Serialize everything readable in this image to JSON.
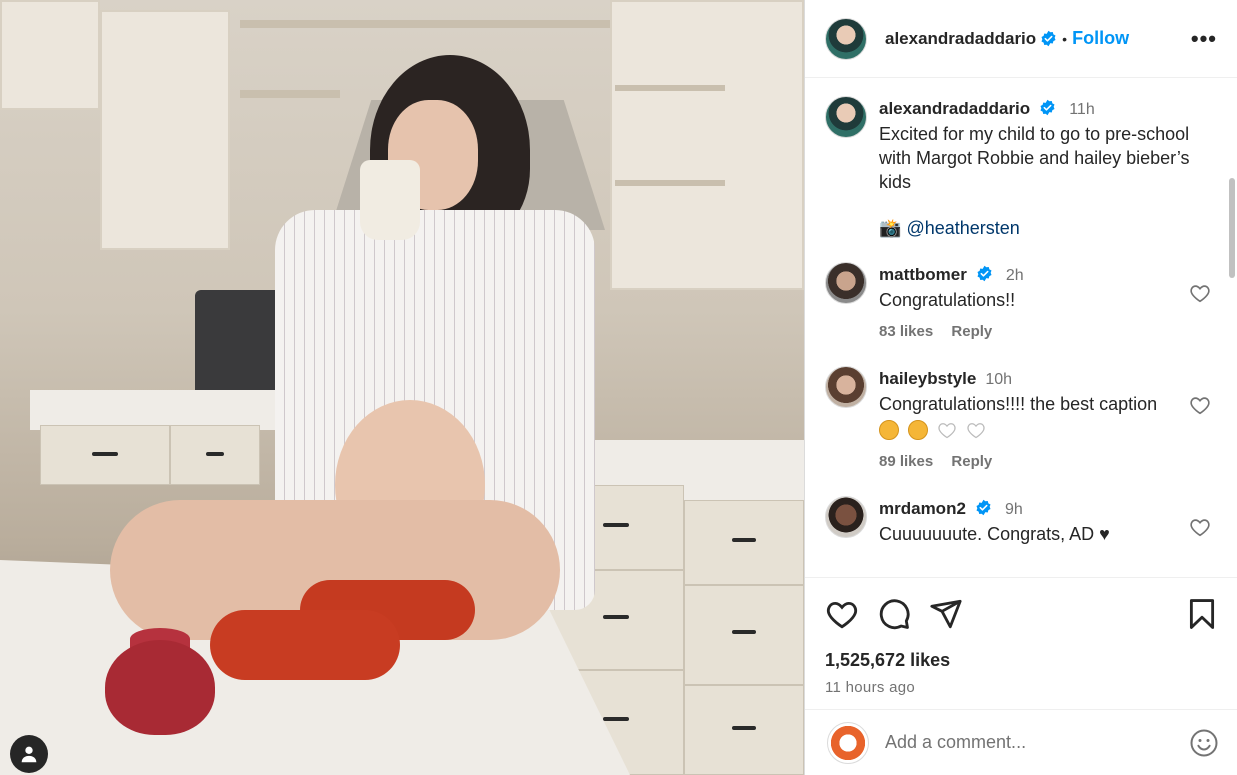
{
  "header": {
    "username": "alexandradaddario",
    "separator": "•",
    "follow_label": "Follow",
    "more_label": "•••"
  },
  "caption": {
    "username": "alexandradaddario",
    "time": "11h",
    "text": "Excited for my child to go to pre-school with Margot Robbie and hailey bieber’s kids",
    "credit_icon": "📸",
    "credit_handle": "@heathersten"
  },
  "comments": [
    {
      "username": "mattbomer",
      "verified": true,
      "time": "2h",
      "text": "Congratulations!!",
      "likes": "83 likes",
      "reply": "Reply"
    },
    {
      "username": "haileybstyle",
      "verified": false,
      "time": "10h",
      "text": "Congratulations!!!! the best caption",
      "likes": "89 likes",
      "reply": "Reply"
    },
    {
      "username": "mrdamon2",
      "verified": true,
      "time": "9h",
      "text": "Cuuuuuuute. Congrats, AD ♥"
    }
  ],
  "actions": {
    "likes": "1,525,672 likes",
    "time_ago": "11 hours ago"
  },
  "add_comment": {
    "placeholder": "Add a comment..."
  },
  "icons": {
    "like": "heart-icon",
    "comment": "comment-icon",
    "share": "share-icon",
    "save": "bookmark-icon",
    "emoji": "smiley-icon",
    "user": "user-icon"
  },
  "colors": {
    "accent": "#0095f6",
    "verified": "#0095f6",
    "text": "#262626",
    "muted": "#737373"
  }
}
